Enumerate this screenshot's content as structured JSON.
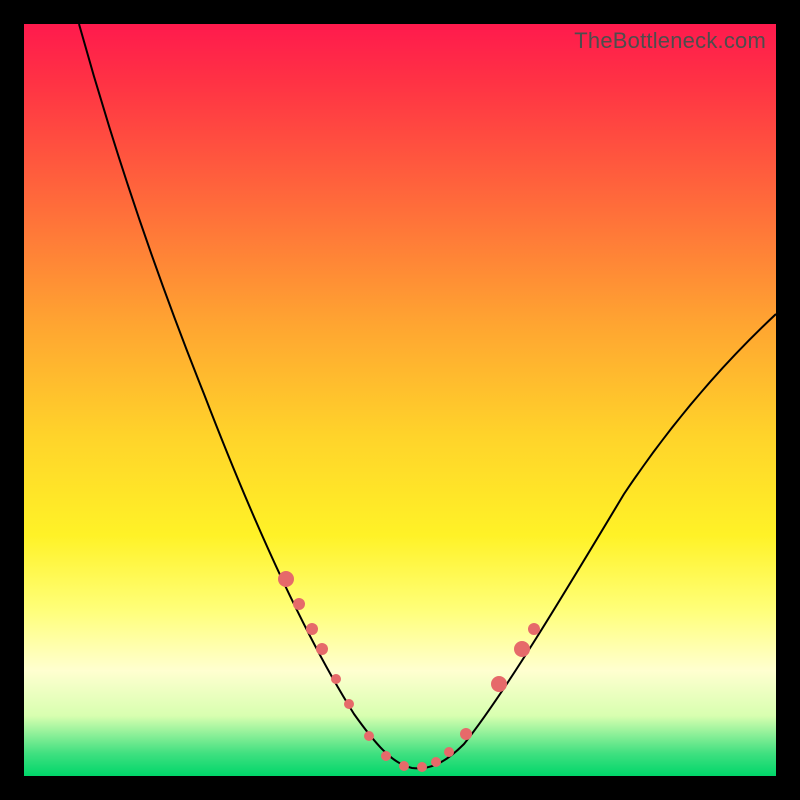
{
  "watermark": "TheBottleneck.com",
  "chart_data": {
    "type": "line",
    "title": "",
    "xlabel": "",
    "ylabel": "",
    "xlim": [
      0,
      100
    ],
    "ylim": [
      0,
      100
    ],
    "grid": false,
    "legend": false,
    "series": [
      {
        "name": "bottleneck-curve",
        "x": [
          0,
          5,
          10,
          15,
          20,
          25,
          30,
          34,
          38,
          42,
          45,
          48,
          50,
          52,
          54,
          56,
          60,
          65,
          70,
          75,
          80,
          85,
          90,
          95,
          100
        ],
        "y": [
          100,
          94,
          87,
          79,
          70,
          60,
          48,
          36,
          24,
          14,
          7,
          2,
          0,
          0,
          1,
          3,
          10,
          20,
          30,
          38,
          45,
          51,
          56,
          60,
          63
        ]
      }
    ],
    "markers": {
      "name": "highlighted-points",
      "color": "#e66a6a",
      "points": [
        {
          "x": 34,
          "y": 36,
          "size": "lg"
        },
        {
          "x": 36,
          "y": 30,
          "size": "md"
        },
        {
          "x": 38,
          "y": 24,
          "size": "md"
        },
        {
          "x": 39,
          "y": 20,
          "size": "md"
        },
        {
          "x": 41,
          "y": 15,
          "size": "sm"
        },
        {
          "x": 43,
          "y": 10,
          "size": "sm"
        },
        {
          "x": 46,
          "y": 5,
          "size": "sm"
        },
        {
          "x": 48,
          "y": 2,
          "size": "sm"
        },
        {
          "x": 50,
          "y": 0,
          "size": "sm"
        },
        {
          "x": 52,
          "y": 0,
          "size": "sm"
        },
        {
          "x": 54,
          "y": 1,
          "size": "sm"
        },
        {
          "x": 56,
          "y": 3,
          "size": "sm"
        },
        {
          "x": 58,
          "y": 7,
          "size": "md"
        },
        {
          "x": 62,
          "y": 15,
          "size": "lg"
        },
        {
          "x": 65,
          "y": 20,
          "size": "lg"
        },
        {
          "x": 66,
          "y": 23,
          "size": "md"
        }
      ]
    },
    "gradient_stops": [
      {
        "pos": 0.0,
        "color": "#ff1a4d"
      },
      {
        "pos": 0.25,
        "color": "#ff6f3a"
      },
      {
        "pos": 0.55,
        "color": "#ffd42a"
      },
      {
        "pos": 0.78,
        "color": "#ffff7a"
      },
      {
        "pos": 0.92,
        "color": "#d8ffb0"
      },
      {
        "pos": 1.0,
        "color": "#00d66a"
      }
    ]
  }
}
